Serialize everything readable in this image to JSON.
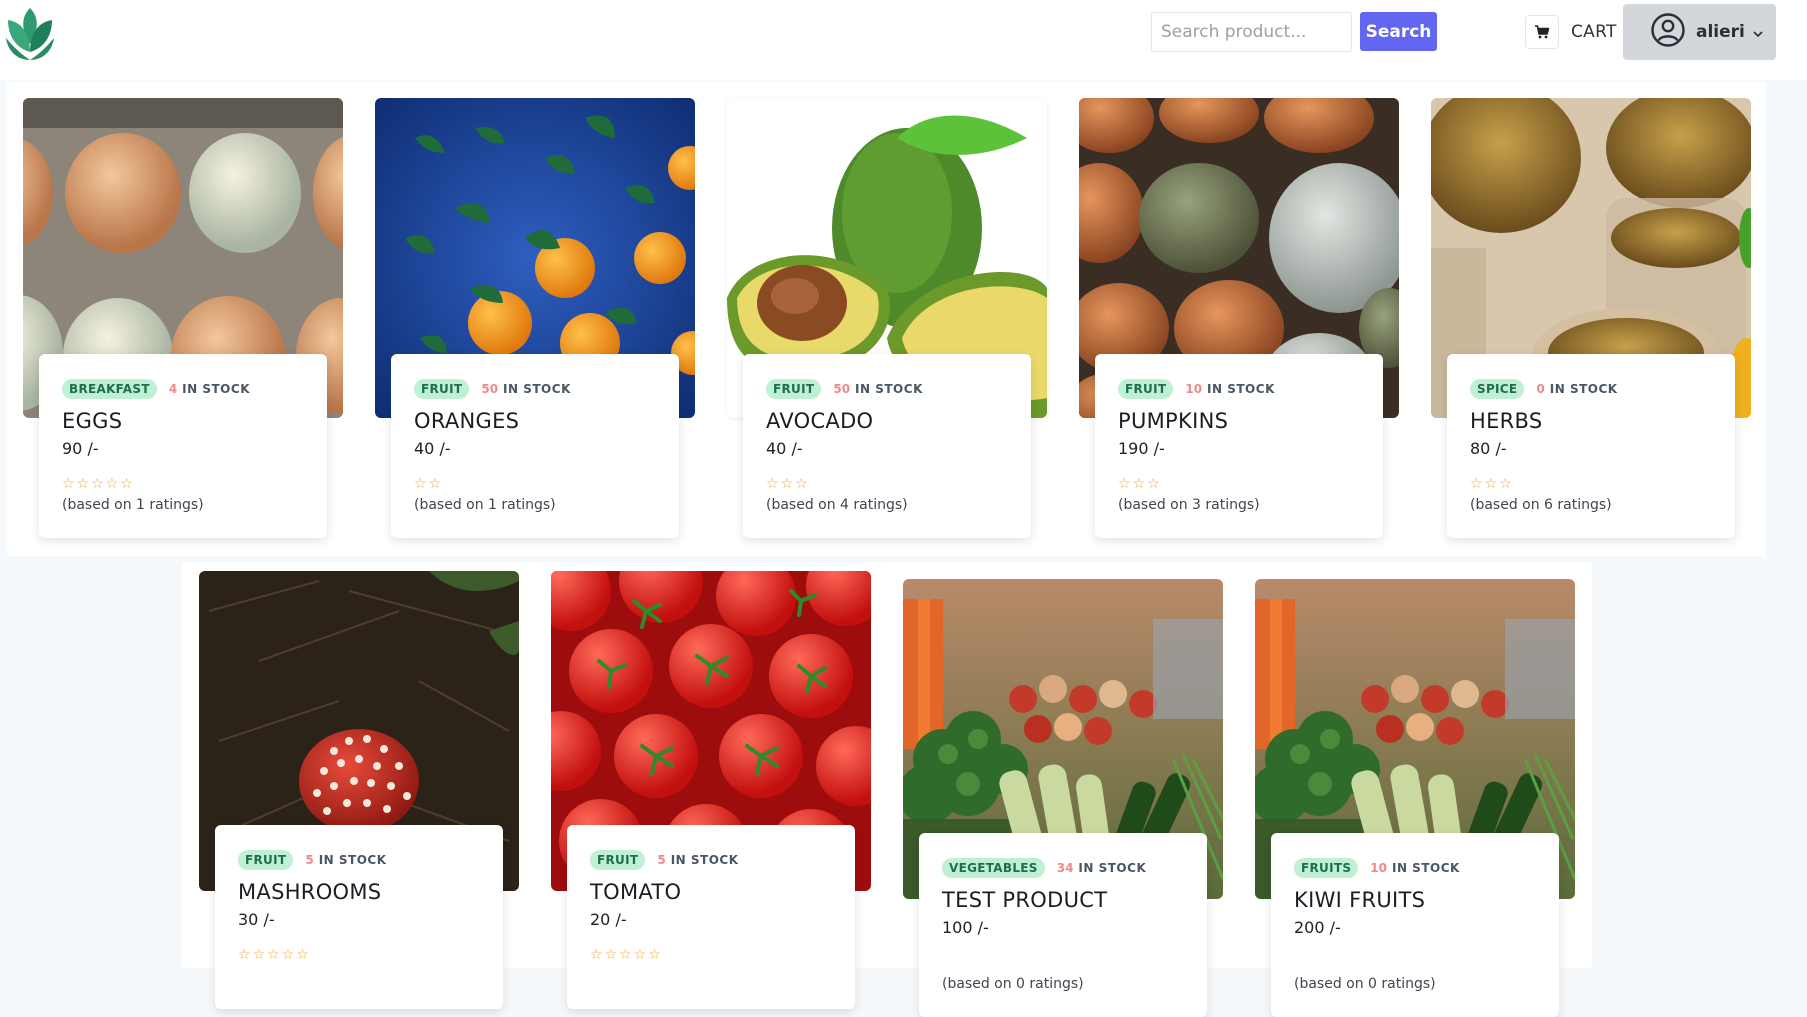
{
  "header": {
    "search_placeholder": "Search product...",
    "search_button": "Search",
    "cart_label": "CART",
    "user_name": "alieri"
  },
  "products": [
    {
      "category": "BREAKFAST",
      "stock": "4",
      "stock_label": "IN STOCK",
      "name": "EGGS",
      "price": "90 /-",
      "stars": "☆☆☆☆☆",
      "ratings": "(based on 1 ratings)"
    },
    {
      "category": "FRUIT",
      "stock": "50",
      "stock_label": "IN STOCK",
      "name": "ORANGES",
      "price": "40 /-",
      "stars": "☆☆",
      "ratings": "(based on 1 ratings)"
    },
    {
      "category": "FRUIT",
      "stock": "50",
      "stock_label": "IN STOCK",
      "name": "AVOCADO",
      "price": "40 /-",
      "stars": "☆☆☆",
      "ratings": "(based on 4 ratings)"
    },
    {
      "category": "FRUIT",
      "stock": "10",
      "stock_label": "IN STOCK",
      "name": "PUMPKINS",
      "price": "190 /-",
      "stars": "☆☆☆",
      "ratings": "(based on 3 ratings)"
    },
    {
      "category": "SPICE",
      "stock": "0",
      "stock_label": "IN STOCK",
      "name": "HERBS",
      "price": "80 /-",
      "stars": "☆☆☆",
      "ratings": "(based on 6 ratings)"
    },
    {
      "category": "FRUIT",
      "stock": "5",
      "stock_label": "IN STOCK",
      "name": "MASHROOMS",
      "price": "30 /-",
      "stars": "☆☆☆☆☆",
      "ratings": ""
    },
    {
      "category": "FRUIT",
      "stock": "5",
      "stock_label": "IN STOCK",
      "name": "TOMATO",
      "price": "20 /-",
      "stars": "☆☆☆☆☆",
      "ratings": ""
    },
    {
      "category": "VEGETABLES",
      "stock": "34",
      "stock_label": "IN STOCK",
      "name": "TEST PRODUCT",
      "price": "100 /-",
      "stars": "",
      "ratings": "(based on 0 ratings)"
    },
    {
      "category": "FRUITS",
      "stock": "10",
      "stock_label": "IN STOCK",
      "name": "KIWI FRUITS",
      "price": "200 /-",
      "stars": "",
      "ratings": "(based on 0 ratings)"
    }
  ],
  "icons": {
    "logo": "leaf-logo-icon",
    "cart": "cart-icon",
    "user": "user-circle-icon",
    "chevron": "chevron-down-icon"
  },
  "colors": {
    "accent": "#6366f1",
    "badge_bg": "#bff0d6",
    "badge_text": "#1d6f4a",
    "stock_count": "#f08a8a",
    "stars": "#f5a623"
  }
}
